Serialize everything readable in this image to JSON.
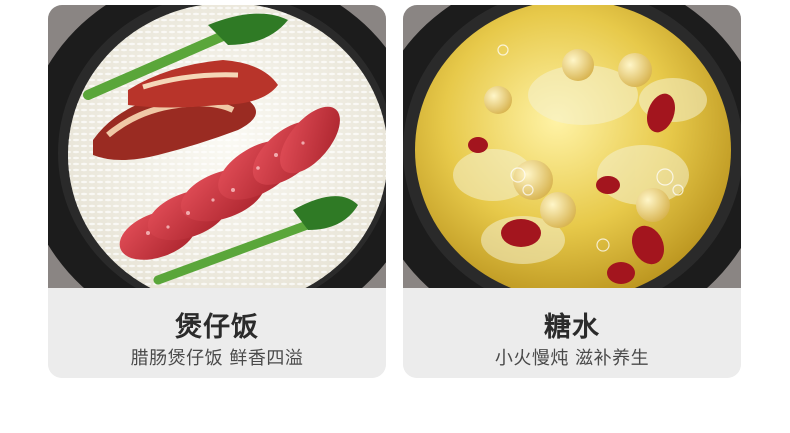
{
  "cards": [
    {
      "title": "煲仔饭",
      "subtitle": "腊肠煲仔饭 鲜香四溢"
    },
    {
      "title": "糖水",
      "subtitle": "小火慢炖 滋补养生"
    }
  ],
  "colors": {
    "card_bg": "#ececec",
    "title": "#2b2b2b",
    "subtitle": "#4a4a4a"
  }
}
